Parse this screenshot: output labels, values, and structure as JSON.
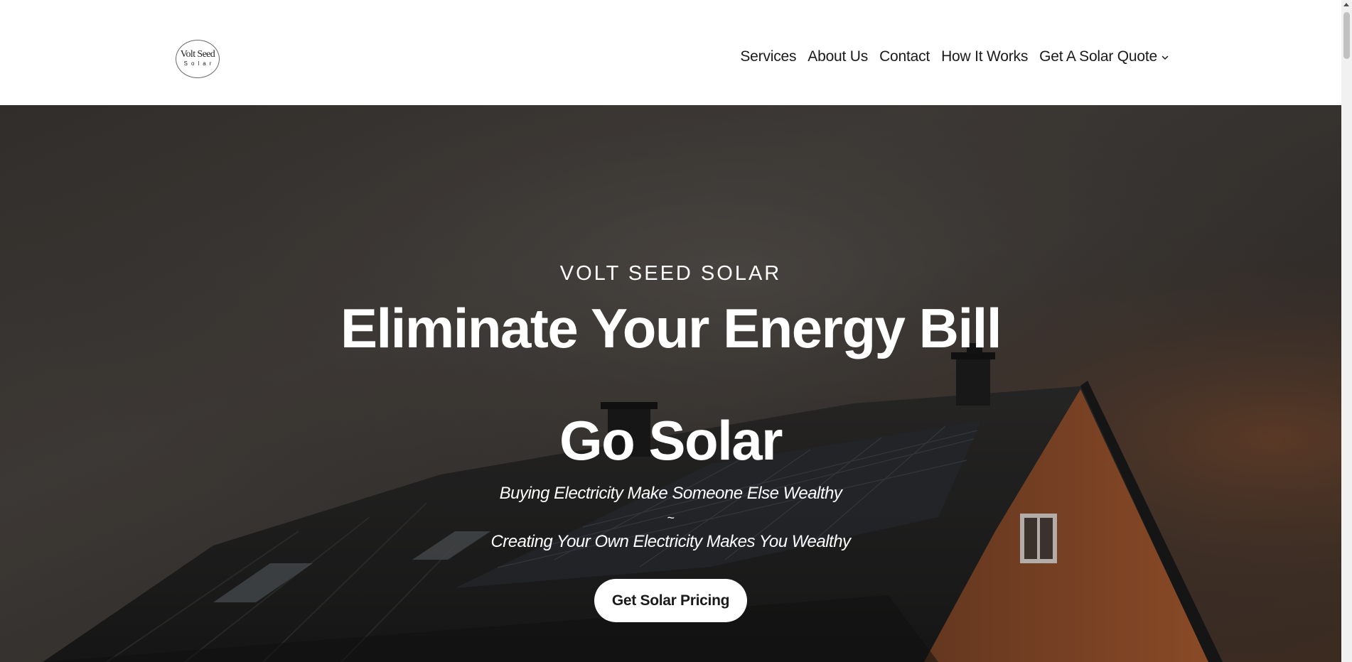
{
  "header": {
    "logo": {
      "line1": "Volt Seed",
      "line2": "Solar"
    },
    "nav": {
      "items": [
        {
          "label": "Services"
        },
        {
          "label": "About Us"
        },
        {
          "label": "Contact"
        },
        {
          "label": "How It Works"
        },
        {
          "label": "Get A Solar Quote",
          "icon": "chevron-down-icon"
        }
      ]
    }
  },
  "hero": {
    "eyebrow": "VOLT SEED SOLAR",
    "title_line1": "Eliminate Your Energy Bill",
    "title_line2": "Go Solar",
    "subtitle_line1": "Buying Electricity Make Someone Else Wealthy",
    "subtitle_separator": "~",
    "subtitle_line2": "Creating Your Own Electricity Makes You Wealthy",
    "cta_label": "Get Solar Pricing",
    "background": "house-with-solar-panels-at-dusk"
  },
  "colors": {
    "header_bg": "#ffffff",
    "hero_text": "#ffffff",
    "nav_text": "#1a1a1a",
    "cta_bg": "#ffffff"
  }
}
